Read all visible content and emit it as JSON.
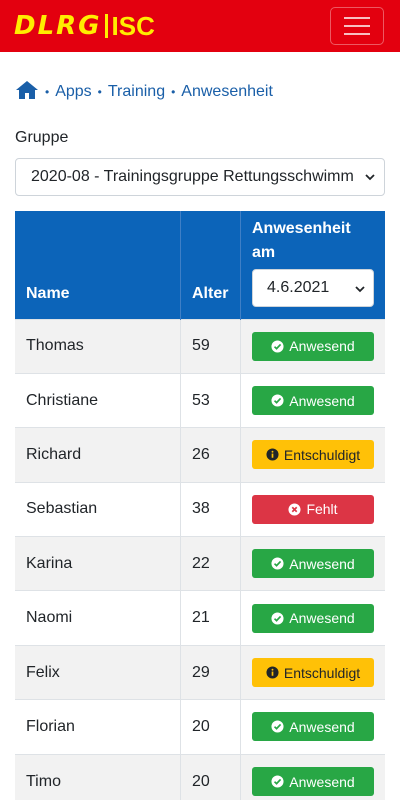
{
  "header": {
    "brand_main": "DLRG",
    "brand_sub": "ISC",
    "colors": {
      "navbar": "#e3000f",
      "brand": "#ffed00"
    }
  },
  "breadcrumb": {
    "home_icon": "home-icon",
    "items": [
      "Apps",
      "Training",
      "Anwesenheit"
    ]
  },
  "group": {
    "label": "Gruppe",
    "selected": "2020-08 - Trainingsgruppe Rettungsschwimm"
  },
  "table": {
    "headers": {
      "name": "Name",
      "age": "Alter",
      "attendance": "Anwesenheit am"
    },
    "date_selected": "4.6.2021",
    "rows": [
      {
        "name": "Thomas",
        "age": "59",
        "status": "Anwesend",
        "type": "present"
      },
      {
        "name": "Christiane",
        "age": "53",
        "status": "Anwesend",
        "type": "present"
      },
      {
        "name": "Richard",
        "age": "26",
        "status": "Entschuldigt",
        "type": "excused"
      },
      {
        "name": "Sebastian",
        "age": "38",
        "status": "Fehlt",
        "type": "absent"
      },
      {
        "name": "Karina",
        "age": "22",
        "status": "Anwesend",
        "type": "present"
      },
      {
        "name": "Naomi",
        "age": "21",
        "status": "Anwesend",
        "type": "present"
      },
      {
        "name": "Felix",
        "age": "29",
        "status": "Entschuldigt",
        "type": "excused"
      },
      {
        "name": "Florian",
        "age": "20",
        "status": "Anwesend",
        "type": "present"
      },
      {
        "name": "Timo",
        "age": "20",
        "status": "Anwesend",
        "type": "present"
      }
    ],
    "status_colors": {
      "present": "#28a745",
      "excused": "#ffc107",
      "absent": "#dc3545",
      "header": "#0c64b9"
    }
  }
}
